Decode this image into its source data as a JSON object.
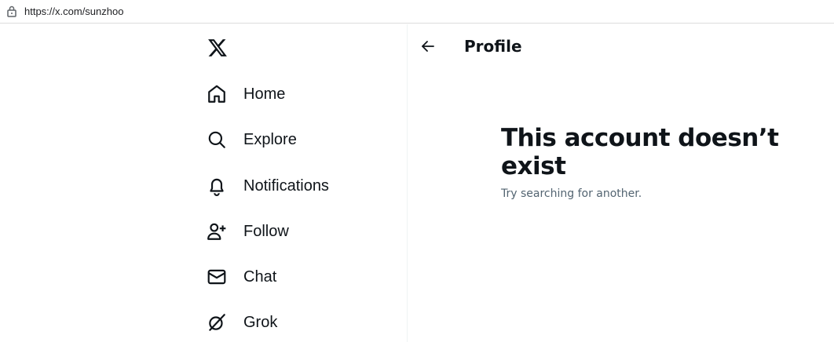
{
  "browser": {
    "url": "https://x.com/sunzhoo",
    "lock_icon": "lock-icon"
  },
  "sidebar": {
    "logo_icon": "x-logo-icon",
    "items": [
      {
        "label": "Home",
        "icon": "home-icon"
      },
      {
        "label": "Explore",
        "icon": "search-icon"
      },
      {
        "label": "Notifications",
        "icon": "bell-icon"
      },
      {
        "label": "Follow",
        "icon": "person-add-icon"
      },
      {
        "label": "Chat",
        "icon": "envelope-icon"
      },
      {
        "label": "Grok",
        "icon": "grok-icon"
      }
    ]
  },
  "header": {
    "back_icon": "arrow-left-icon",
    "title": "Profile"
  },
  "main": {
    "empty_title": "This account doesn’t exist",
    "empty_subtitle": "Try searching for another."
  },
  "colors": {
    "text_primary": "#0f1419",
    "text_secondary": "#536471",
    "divider": "#eff3f4"
  }
}
